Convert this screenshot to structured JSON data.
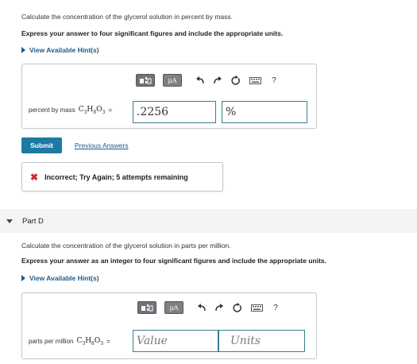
{
  "partC": {
    "question": "Calculate the concentration of the glycerol solution in percent by mass.",
    "instruction": "Express your answer to four significant figures and include the appropriate units.",
    "hint_link": "View Available Hint(s)",
    "label_prefix": "percent by mass",
    "value": ".2256",
    "units": "%",
    "submit_label": "Submit",
    "previous_answers_label": "Previous Answers",
    "feedback_text": "Incorrect; Try Again; 5 attempts remaining"
  },
  "partD": {
    "title": "Part D",
    "question": "Calculate the concentration of the glycerol solution in parts per million.",
    "instruction": "Express your answer as an integer to four significant figures and include the appropriate units.",
    "hint_link": "View Available Hint(s)",
    "label_prefix": "parts per million",
    "value_placeholder": "Value",
    "units_placeholder": "Units"
  },
  "toolbar": {
    "mu_label": "μA",
    "help_label": "?",
    "icons": [
      "templates-icon",
      "units-icon",
      "undo-icon",
      "redo-icon",
      "reset-icon",
      "keyboard-icon",
      "help-icon"
    ]
  },
  "formula": {
    "c": "C",
    "c_sub": "3",
    "h": "H",
    "h_sub": "8",
    "o": "O",
    "o_sub": "3",
    "equals": "="
  },
  "colors": {
    "link": "#1a5c8c",
    "submit": "#1f7aa3",
    "field_border": "#3a7d90",
    "incorrect": "#d0282c"
  }
}
